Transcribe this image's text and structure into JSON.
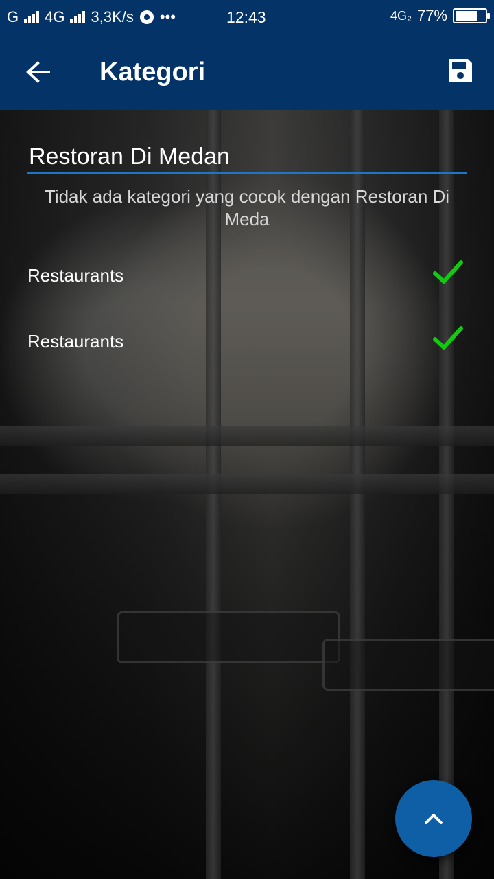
{
  "status_bar": {
    "carrier": "G",
    "network": "4G",
    "speed": "3,3K/s",
    "more": "•••",
    "time": "12:43",
    "network_right": "4G₂",
    "battery_percent": "77%",
    "battery_level": 0.77
  },
  "app_bar": {
    "title": "Kategori",
    "back_icon": "arrow-left-icon",
    "save_icon": "save-icon"
  },
  "search": {
    "value": "Restoran Di Medan"
  },
  "message": "Tidak ada kategori yang cocok dengan Restoran Di Meda",
  "results": [
    {
      "label": "Restaurants",
      "icon": "check-icon",
      "check_color": "#14c814"
    },
    {
      "label": "Restaurants",
      "icon": "check-icon",
      "check_color": "#14c814"
    }
  ],
  "fab": {
    "icon": "chevron-up-icon"
  },
  "colors": {
    "app_bar": "#043367",
    "accent": "#1e76c5",
    "fab": "#0e5fa6"
  }
}
